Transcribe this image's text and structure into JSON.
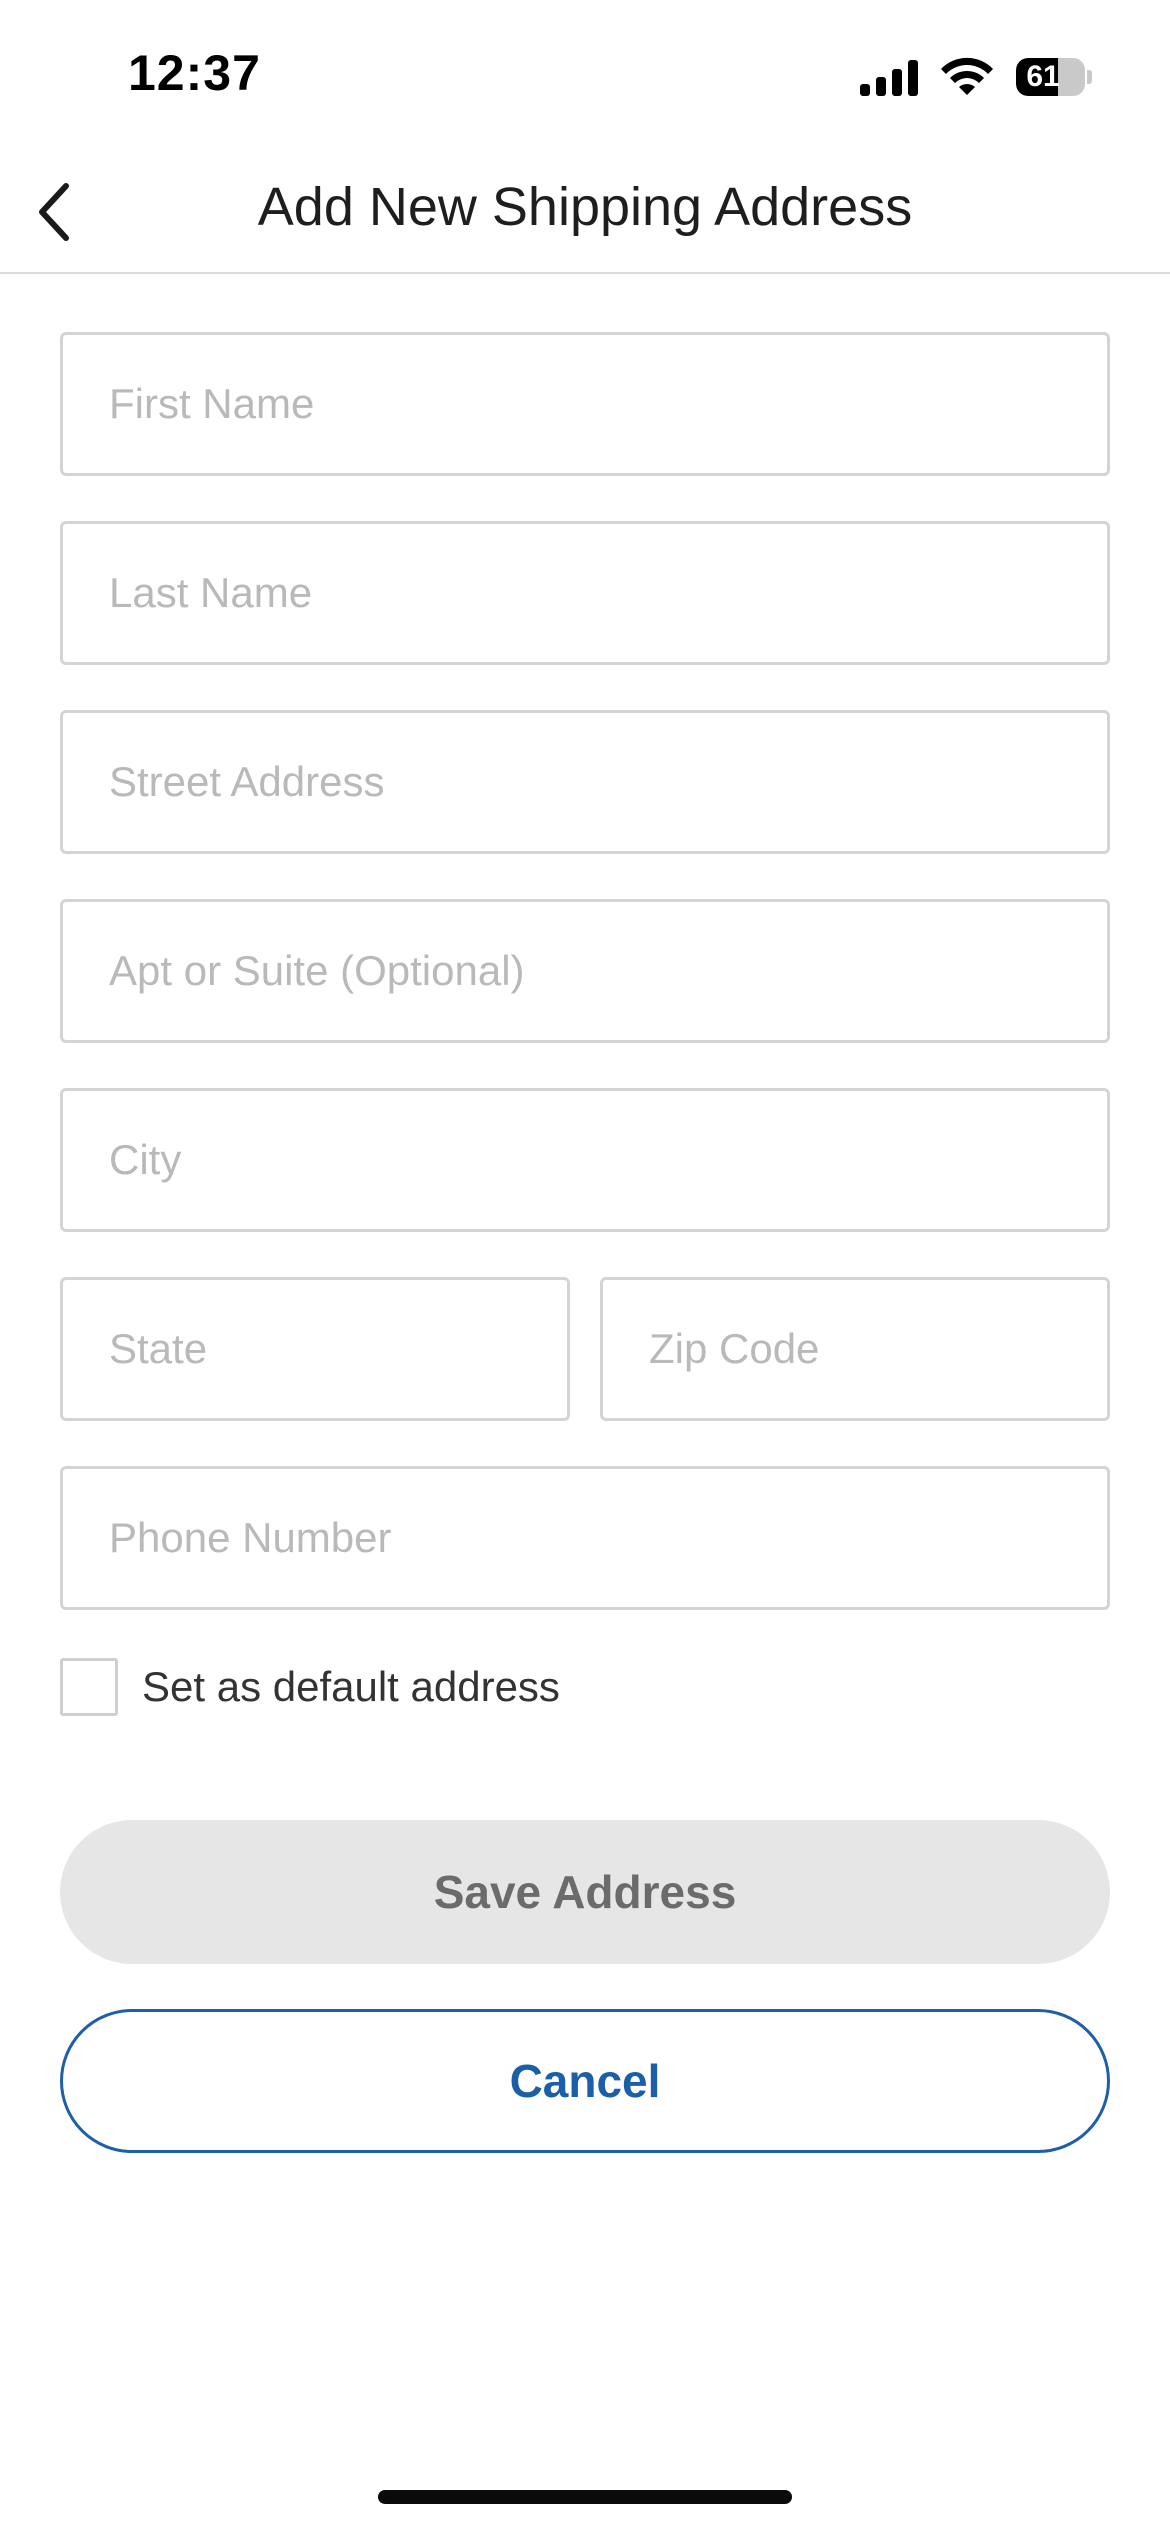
{
  "status_bar": {
    "time": "12:37",
    "battery_level": "61",
    "battery_fraction": 0.61
  },
  "header": {
    "title": "Add New Shipping Address",
    "back_icon": "chevron-left-icon"
  },
  "form": {
    "first_name": {
      "placeholder": "First Name",
      "value": ""
    },
    "last_name": {
      "placeholder": "Last Name",
      "value": ""
    },
    "street_address": {
      "placeholder": "Street Address",
      "value": ""
    },
    "apt_suite": {
      "placeholder": "Apt or Suite (Optional)",
      "value": ""
    },
    "city": {
      "placeholder": "City",
      "value": ""
    },
    "state": {
      "placeholder": "State",
      "value": ""
    },
    "zip_code": {
      "placeholder": "Zip Code",
      "value": ""
    },
    "phone_number": {
      "placeholder": "Phone Number",
      "value": ""
    },
    "default_checkbox": {
      "label": "Set as default address",
      "checked": false
    }
  },
  "actions": {
    "save_label": "Save Address",
    "cancel_label": "Cancel"
  },
  "colors": {
    "accent": "#1b5fa8",
    "disabled_button_bg": "#e6e6e6",
    "disabled_button_text": "#6b6b6b",
    "field_border": "#d4d4d4",
    "placeholder": "#b9b9b9"
  }
}
